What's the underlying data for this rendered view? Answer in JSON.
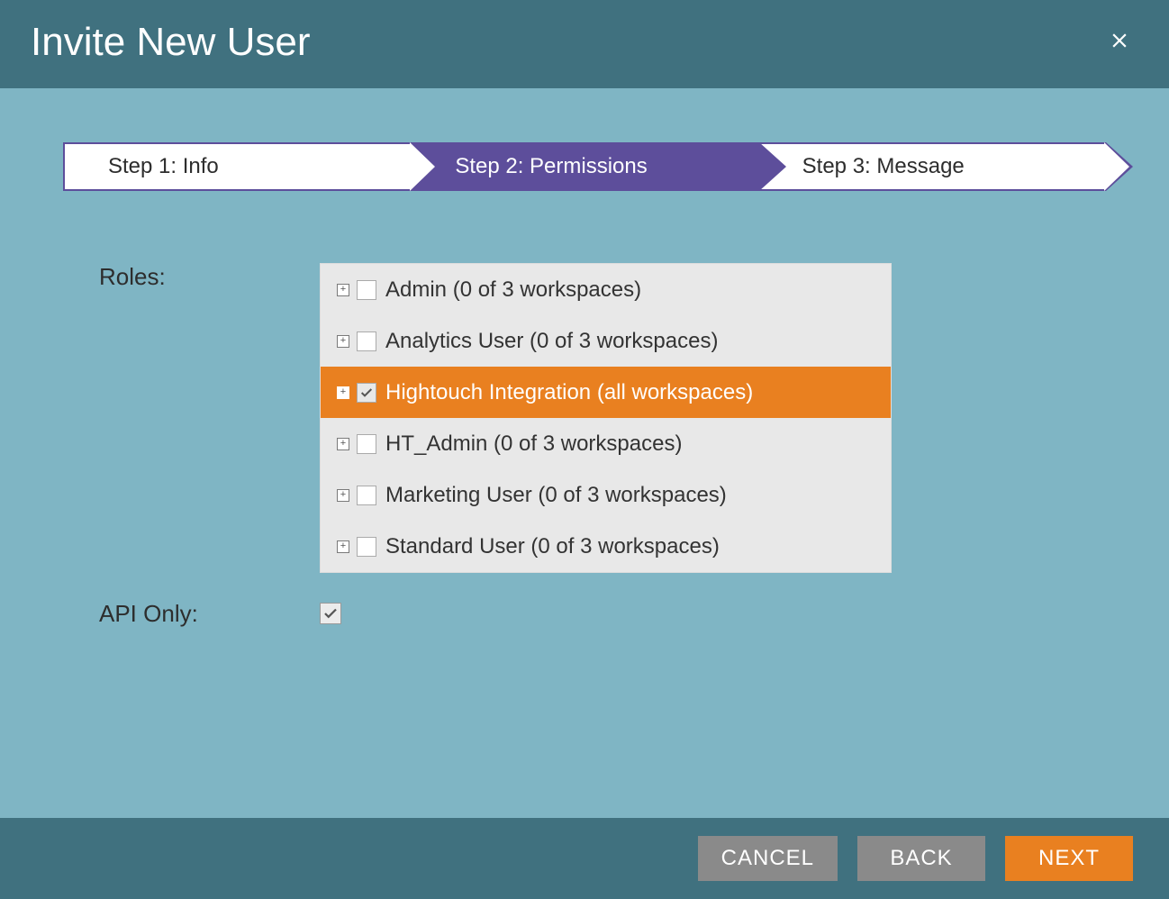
{
  "header": {
    "title": "Invite New User"
  },
  "stepper": {
    "steps": [
      {
        "label": "Step 1: Info",
        "active": false
      },
      {
        "label": "Step 2: Permissions",
        "active": true
      },
      {
        "label": "Step 3: Message",
        "active": false
      }
    ]
  },
  "form": {
    "roles_label": "Roles:",
    "api_only_label": "API Only:",
    "api_only_checked": true
  },
  "roles": [
    {
      "label": "Admin (0 of 3 workspaces)",
      "checked": false,
      "selected": false
    },
    {
      "label": "Analytics User (0 of 3 workspaces)",
      "checked": false,
      "selected": false
    },
    {
      "label": "Hightouch Integration (all workspaces)",
      "checked": true,
      "selected": true
    },
    {
      "label": "HT_Admin (0 of 3 workspaces)",
      "checked": false,
      "selected": false
    },
    {
      "label": "Marketing User (0 of 3 workspaces)",
      "checked": false,
      "selected": false
    },
    {
      "label": "Standard User (0 of 3 workspaces)",
      "checked": false,
      "selected": false
    }
  ],
  "footer": {
    "cancel": "CANCEL",
    "back": "BACK",
    "next": "NEXT"
  },
  "icons": {
    "close": "close-icon",
    "expand": "plus-square-icon",
    "check": "checkmark-icon"
  }
}
